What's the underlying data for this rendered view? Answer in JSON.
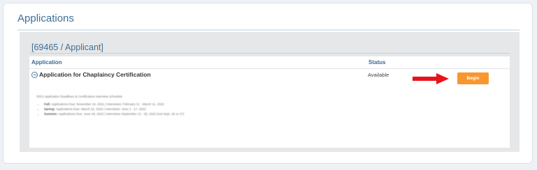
{
  "page": {
    "title": "Applications"
  },
  "applicant": {
    "heading": "[69465 / Applicant]"
  },
  "table": {
    "headers": {
      "application": "Application",
      "status": "Status"
    },
    "rows": [
      {
        "name": "Application for Chaplaincy Certification",
        "status": "Available",
        "action_label": "Begin"
      }
    ]
  },
  "notes": {
    "title": "2022 Application Deadlines & Certification Interview Schedule",
    "items": [
      {
        "term": "Fall:",
        "text": "Applications Due: November 16, 2021 | Interviews: February 21 - March 11, 2022"
      },
      {
        "term": "Spring:",
        "text": "Applications Due: March 22, 2022 | Interviews: June 1 - 17, 2022"
      },
      {
        "term": "Summer:",
        "text": "Applications Due: June 28, 2022 | Interviews September 12 - 30, 2022 (not Sept. 26 or 27)"
      }
    ]
  },
  "colors": {
    "accent": "#3f6f97",
    "button": "#f7972e",
    "arrow": "#e8121b"
  },
  "icons": {
    "toggle": "collapse-circle-icon",
    "pointer": "red-arrow-icon"
  }
}
